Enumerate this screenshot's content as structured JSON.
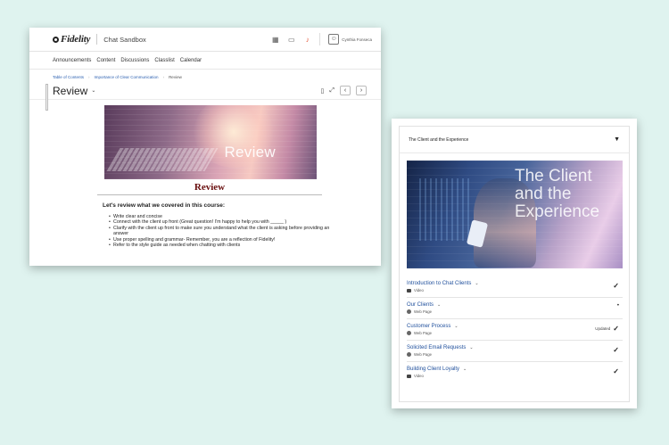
{
  "left_window": {
    "brand": "Fidelity",
    "course_title": "Chat Sandbox",
    "top_icons": [
      "apps-grid-icon",
      "chat-icon",
      "bell-alert-icon"
    ],
    "user_name": "Cynthia Fonseca",
    "nav": [
      "Announcements",
      "Content",
      "Discussions",
      "Classlist",
      "Calendar"
    ],
    "breadcrumb": [
      "Table of Contents",
      "Importance of Clear Communication",
      "Review"
    ],
    "page_title": "Review",
    "banner_text": "Review",
    "content_heading": "Review",
    "lead": "Let's review what we covered in this course:",
    "bullets": [
      "Write clear and concise",
      "Connect with the client up front (Great question! I'm happy to help you with _____ )",
      "Clarify with the client up front to make sure you understand what the client is asking before providing an answer",
      "Use proper spelling and grammar- Remember, you are a reflection of Fidelity!",
      "Refer to the style guide as needed when chatting with clients"
    ]
  },
  "right_window": {
    "header": "The Client and the Experience",
    "hero_text": "The Client and the Experience",
    "lessons": [
      {
        "title": "Introduction to Chat Clients",
        "type": "Video",
        "status": "",
        "mark": "check"
      },
      {
        "title": "Our Clients",
        "type": "Web Page",
        "status": "",
        "mark": "dot"
      },
      {
        "title": "Customer Process",
        "type": "Web Page",
        "status": "Updated",
        "mark": "check"
      },
      {
        "title": "Solicited Email Requests",
        "type": "Web Page",
        "status": "",
        "mark": "check"
      },
      {
        "title": "Building Client Loyalty",
        "type": "Video",
        "status": "",
        "mark": "check"
      }
    ]
  },
  "colors": {
    "background": "#dff3ef",
    "link": "#1f4f9c",
    "heading_red": "#6a1010"
  }
}
